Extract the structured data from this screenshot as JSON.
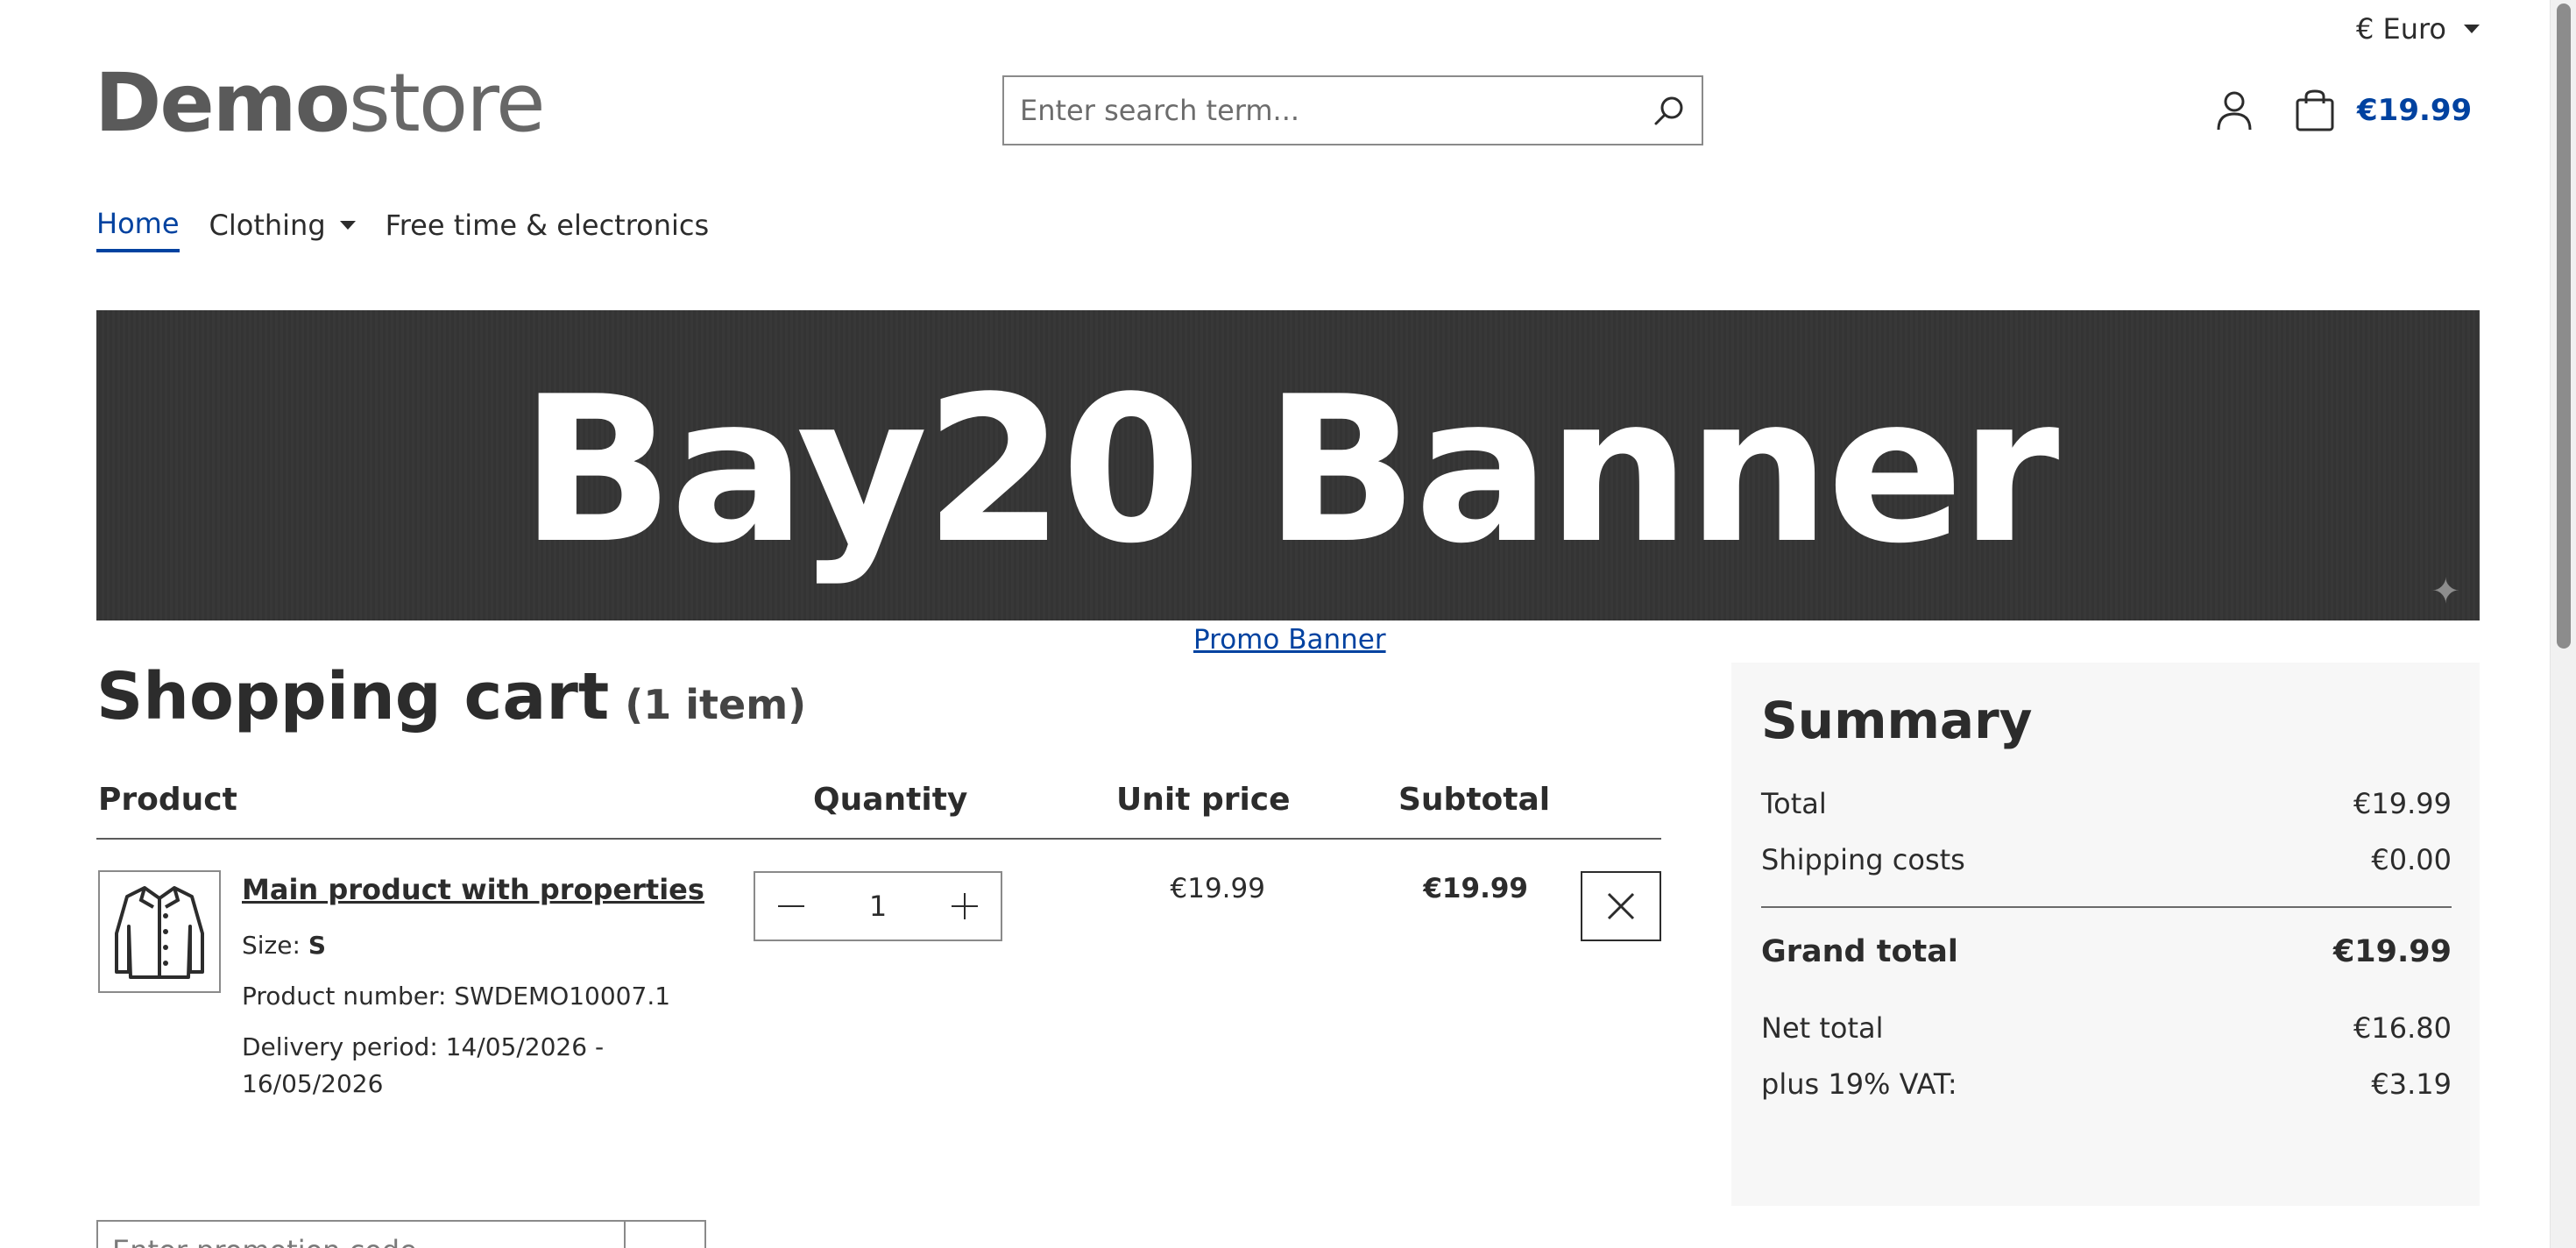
{
  "header": {
    "currency": "€ Euro",
    "logo_bold": "Demo",
    "logo_light": "store",
    "search_placeholder": "Enter search term...",
    "cart_total": "€19.99"
  },
  "nav": {
    "items": [
      {
        "label": "Home"
      },
      {
        "label": "Clothing"
      },
      {
        "label": "Free time & electronics"
      }
    ]
  },
  "banner": {
    "text": "Bay20 Banner",
    "link": "Promo Banner"
  },
  "cart": {
    "title": "Shopping cart",
    "count": "(1 item)",
    "columns": {
      "product": "Product",
      "quantity": "Quantity",
      "unit_price": "Unit price",
      "subtotal": "Subtotal"
    },
    "items": [
      {
        "name": "Main product with properties",
        "size_label": "Size:",
        "size_value": "S",
        "product_number": "Product number: SWDEMO10007.1",
        "delivery_line1": "Delivery period: 14/05/2026 -",
        "delivery_line2": "16/05/2026",
        "quantity": "1",
        "unit_price": "€19.99",
        "subtotal": "€19.99"
      }
    ]
  },
  "summary": {
    "title": "Summary",
    "total_label": "Total",
    "total_value": "€19.99",
    "shipping_label": "Shipping costs",
    "shipping_value": "€0.00",
    "grand_label": "Grand total",
    "grand_value": "€19.99",
    "net_label": "Net total",
    "net_value": "€16.80",
    "vat_label": "plus 19% VAT:",
    "vat_value": "€3.19"
  },
  "promo": {
    "placeholder": "Enter promotion code..."
  },
  "colors": {
    "accent": "#0042a0",
    "banner_bg": "#353535",
    "summary_bg": "#f7f7f7"
  }
}
